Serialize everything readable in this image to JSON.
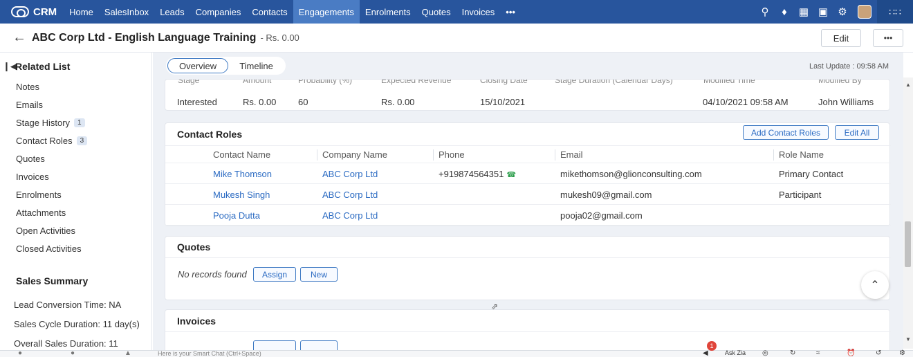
{
  "nav": {
    "brand": "CRM",
    "items": [
      "Home",
      "SalesInbox",
      "Leads",
      "Companies",
      "Contacts",
      "Engagements",
      "Enrolments",
      "Quotes",
      "Invoices",
      "•••"
    ],
    "active_index": 5
  },
  "record": {
    "title": "ABC Corp Ltd - English Language Training",
    "amount": "- Rs. 0.00",
    "edit_label": "Edit",
    "more_label": "•••"
  },
  "sidebar": {
    "title": "Related List",
    "items": [
      {
        "label": "Notes"
      },
      {
        "label": "Emails"
      },
      {
        "label": "Stage History",
        "badge": "1"
      },
      {
        "label": "Contact Roles",
        "badge": "3"
      },
      {
        "label": "Quotes"
      },
      {
        "label": "Invoices"
      },
      {
        "label": "Enrolments"
      },
      {
        "label": "Attachments"
      },
      {
        "label": "Open Activities"
      },
      {
        "label": "Closed Activities"
      }
    ],
    "summary_title": "Sales Summary",
    "summary": [
      "Lead Conversion Time: NA",
      "Sales Cycle Duration: 11 day(s)",
      "Overall Sales Duration: 11"
    ]
  },
  "tabs": {
    "overview": "Overview",
    "timeline": "Timeline"
  },
  "last_update": "Last Update : 09:58 AM",
  "stage_history": {
    "headers": [
      "Stage",
      "Amount",
      "Probability (%)",
      "Expected Revenue",
      "Closing Date",
      "Stage Duration (Calendar Days)",
      "Modified Time",
      "Modified By"
    ],
    "row": [
      "Interested",
      "Rs. 0.00",
      "60",
      "Rs. 0.00",
      "15/10/2021",
      "",
      "04/10/2021 09:58 AM",
      "John Williams"
    ]
  },
  "contact_roles": {
    "title": "Contact Roles",
    "add_label": "Add Contact Roles",
    "edit_all_label": "Edit All",
    "headers": [
      "Contact Name",
      "Company Name",
      "Phone",
      "Email",
      "Role Name"
    ],
    "rows": [
      [
        "Mike Thomson",
        "ABC Corp Ltd",
        "+919874564351",
        "mikethomson@glionconsulting.com",
        "Primary Contact"
      ],
      [
        "Mukesh Singh",
        "ABC Corp Ltd",
        "",
        "mukesh09@gmail.com",
        "Participant"
      ],
      [
        "Pooja Dutta",
        "ABC Corp Ltd",
        "",
        "pooja02@gmail.com",
        ""
      ]
    ]
  },
  "quotes": {
    "title": "Quotes",
    "empty": "No records found",
    "assign": "Assign",
    "new": "New"
  },
  "invoices": {
    "title": "Invoices"
  },
  "bottom": {
    "chat_placeholder": "Here is your Smart Chat (Ctrl+Space)",
    "ask_zia": "Ask Zia",
    "notif_count": "1"
  }
}
